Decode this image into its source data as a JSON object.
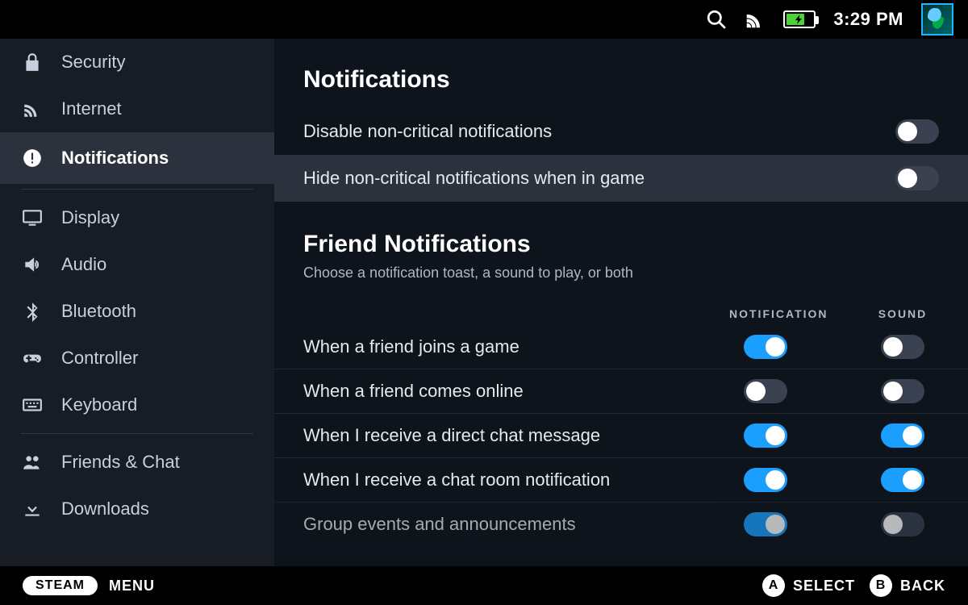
{
  "statusbar": {
    "clock": "3:29 PM"
  },
  "sidebar": {
    "items": [
      {
        "id": "security",
        "label": "Security",
        "icon": "lock"
      },
      {
        "id": "internet",
        "label": "Internet",
        "icon": "wifi"
      },
      {
        "id": "notifications",
        "label": "Notifications",
        "icon": "alert",
        "selected": true
      },
      {
        "id": "display",
        "label": "Display",
        "icon": "monitor"
      },
      {
        "id": "audio",
        "label": "Audio",
        "icon": "speaker"
      },
      {
        "id": "bluetooth",
        "label": "Bluetooth",
        "icon": "bluetooth"
      },
      {
        "id": "controller",
        "label": "Controller",
        "icon": "gamepad"
      },
      {
        "id": "keyboard",
        "label": "Keyboard",
        "icon": "keyboard"
      },
      {
        "id": "friends",
        "label": "Friends & Chat",
        "icon": "friends"
      },
      {
        "id": "downloads",
        "label": "Downloads",
        "icon": "download"
      }
    ]
  },
  "main": {
    "title": "Notifications",
    "toggles": [
      {
        "id": "disable-noncritical",
        "label": "Disable non-critical notifications",
        "on": false,
        "highlight": false
      },
      {
        "id": "hide-noncritical-ingame",
        "label": "Hide non-critical notifications when in game",
        "on": false,
        "highlight": true
      }
    ],
    "friend_section": {
      "title": "Friend Notifications",
      "subtitle": "Choose a notification toast, a sound to play, or both",
      "columns": {
        "notification": "NOTIFICATION",
        "sound": "SOUND"
      },
      "rows": [
        {
          "id": "friend-joins-game",
          "label": "When a friend joins a game",
          "notification": true,
          "sound": false
        },
        {
          "id": "friend-online",
          "label": "When a friend comes online",
          "notification": false,
          "sound": false
        },
        {
          "id": "direct-chat",
          "label": "When I receive a direct chat message",
          "notification": true,
          "sound": true
        },
        {
          "id": "chatroom-notify",
          "label": "When I receive a chat room notification",
          "notification": true,
          "sound": true
        },
        {
          "id": "group-events",
          "label": "Group events and announcements",
          "notification": true,
          "sound": false,
          "cutoff": true
        }
      ]
    }
  },
  "bottombar": {
    "steam": "STEAM",
    "menu": "MENU",
    "select_key": "A",
    "select_label": "SELECT",
    "back_key": "B",
    "back_label": "BACK"
  }
}
